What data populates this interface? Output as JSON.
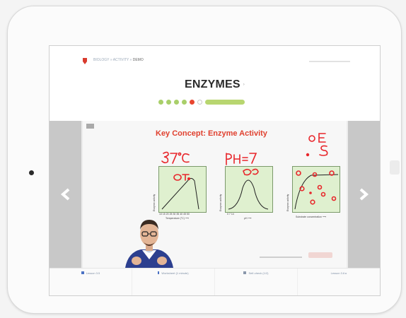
{
  "breadcrumb": {
    "items": [
      "BIOLOGY",
      "ACTIVITY",
      "DEMO"
    ],
    "current_index": 2
  },
  "page": {
    "title": "ENZYMES",
    "subtitle": "›"
  },
  "progress": {
    "dots": [
      "done",
      "done",
      "done",
      "done",
      "current",
      "empty"
    ],
    "pill_color": "#b8d670"
  },
  "slide": {
    "title": "Key Concept: Enzyme Activity",
    "graphs": [
      {
        "ylabel": "Enzyme activity",
        "xlabel": "Temperature (°C) ⟶",
        "ticks": "10 15 20 25 30 35 40 45 50"
      },
      {
        "ylabel": "Enzyme activity",
        "xlabel": "pH ⟶",
        "ticks": "0       7       14"
      },
      {
        "ylabel": "Enzyme activity",
        "xlabel": "Substrate concentration ⟶",
        "ticks": ""
      }
    ],
    "annotations": [
      "37°C",
      "pH=7",
      "OT",
      "Opt",
      "o E",
      "• S"
    ]
  },
  "bottom_bar": [
    {
      "label": "Lesson 3.5"
    },
    {
      "label": "Worksheet (1 minute)"
    },
    {
      "label": "Self-check (1/2)"
    },
    {
      "label": "Lesson 3.6 ▸"
    }
  ],
  "colors": {
    "accent": "#e0412f",
    "ink": "#e8262b",
    "graph_fill": "#dff0cf",
    "link": "#4b72c4"
  }
}
